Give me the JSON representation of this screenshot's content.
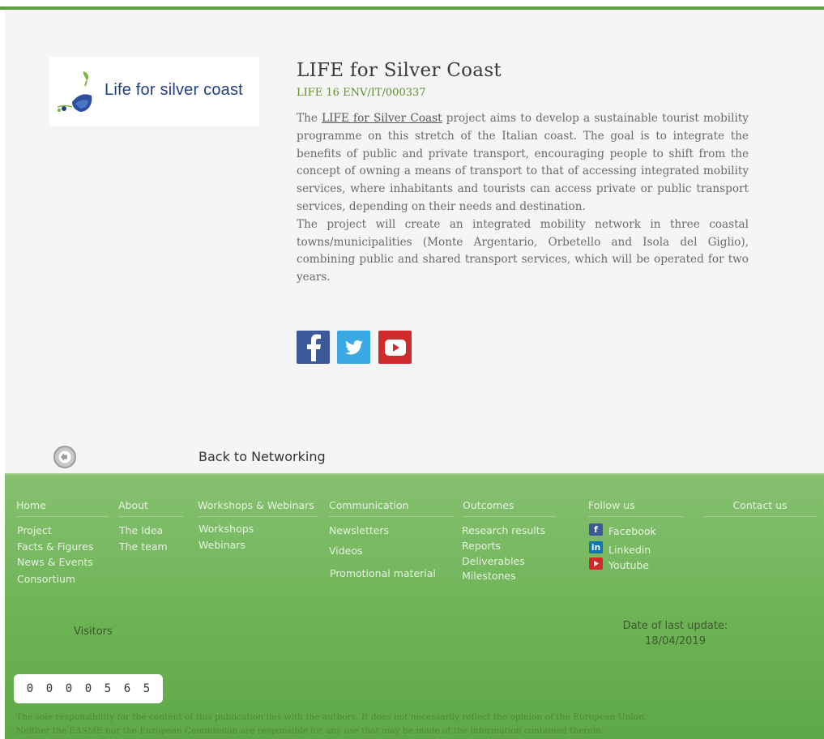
{
  "project": {
    "logo_text": "Life for silver coast",
    "title": "LIFE for Silver Coast",
    "code": "LIFE 16 ENV/IT/000337",
    "intro_prefix": "The ",
    "intro_link": "LIFE for Silver Coast",
    "intro_rest": " project aims to develop a sustainable tourist mobility programme on this stretch of the Italian coast. The goal is to integrate the benefits of public and private transport, encouraging people to shift from the concept of owning a means of transport to that of accessing integrated mobility services, where inhabitants and tourists can access private or public transport services, depending on their needs and destination.",
    "paragraph2": "The project will create an integrated mobility network in three coastal towns/municipalities (Monte Argentario, Orbetello and Isola del Giglio), combining public and shared transport services, which will be operated for two years."
  },
  "social": {
    "icons": [
      "facebook-icon",
      "twitter-icon",
      "youtube-icon"
    ],
    "colors": {
      "facebook": "#3b5998",
      "twitter": "#3aa9e3",
      "youtube": "#d12a2a"
    }
  },
  "back_link": "Back to Networking",
  "footer": {
    "home": {
      "head": "Home",
      "links": [
        "Project",
        "Facts & Figures",
        "News & Events",
        "Consortium"
      ]
    },
    "about": {
      "head": "About",
      "links": [
        "The Idea",
        "The team"
      ]
    },
    "workshops": {
      "head": "Workshops & Webinars",
      "links": [
        "Workshops",
        "Webinars"
      ]
    },
    "communication": {
      "head": "Communication",
      "links": [
        "Newsletters",
        "Videos",
        "Promotional material"
      ]
    },
    "outcomes": {
      "head": "Outcomes",
      "links": [
        "Research results",
        "Reports",
        "Deliverables",
        "Milestones"
      ]
    },
    "follow": {
      "head": "Follow us",
      "links": [
        "Facebook",
        "Linkedin",
        "Youtube"
      ]
    },
    "contact": {
      "head": "Contact us"
    },
    "visitors_label": "Visitors",
    "counter_digits": [
      "0",
      "0",
      "0",
      "0",
      "5",
      "6",
      "5"
    ],
    "update_label": "Date of last update:",
    "update_date": "18/04/2019",
    "disclaimer_line1": "The sole responsibility for the content of this publication lies with the authors. It does not necessarily reflect the opinion of the European Union.",
    "disclaimer_line2": "Neither the EASME nor the European Commission are responsible for any use that may be made of the information contained therein."
  },
  "colors": {
    "accent_green": "#5d8e2c",
    "footer_green": "#6db355",
    "logo_blue": "#233d86"
  }
}
